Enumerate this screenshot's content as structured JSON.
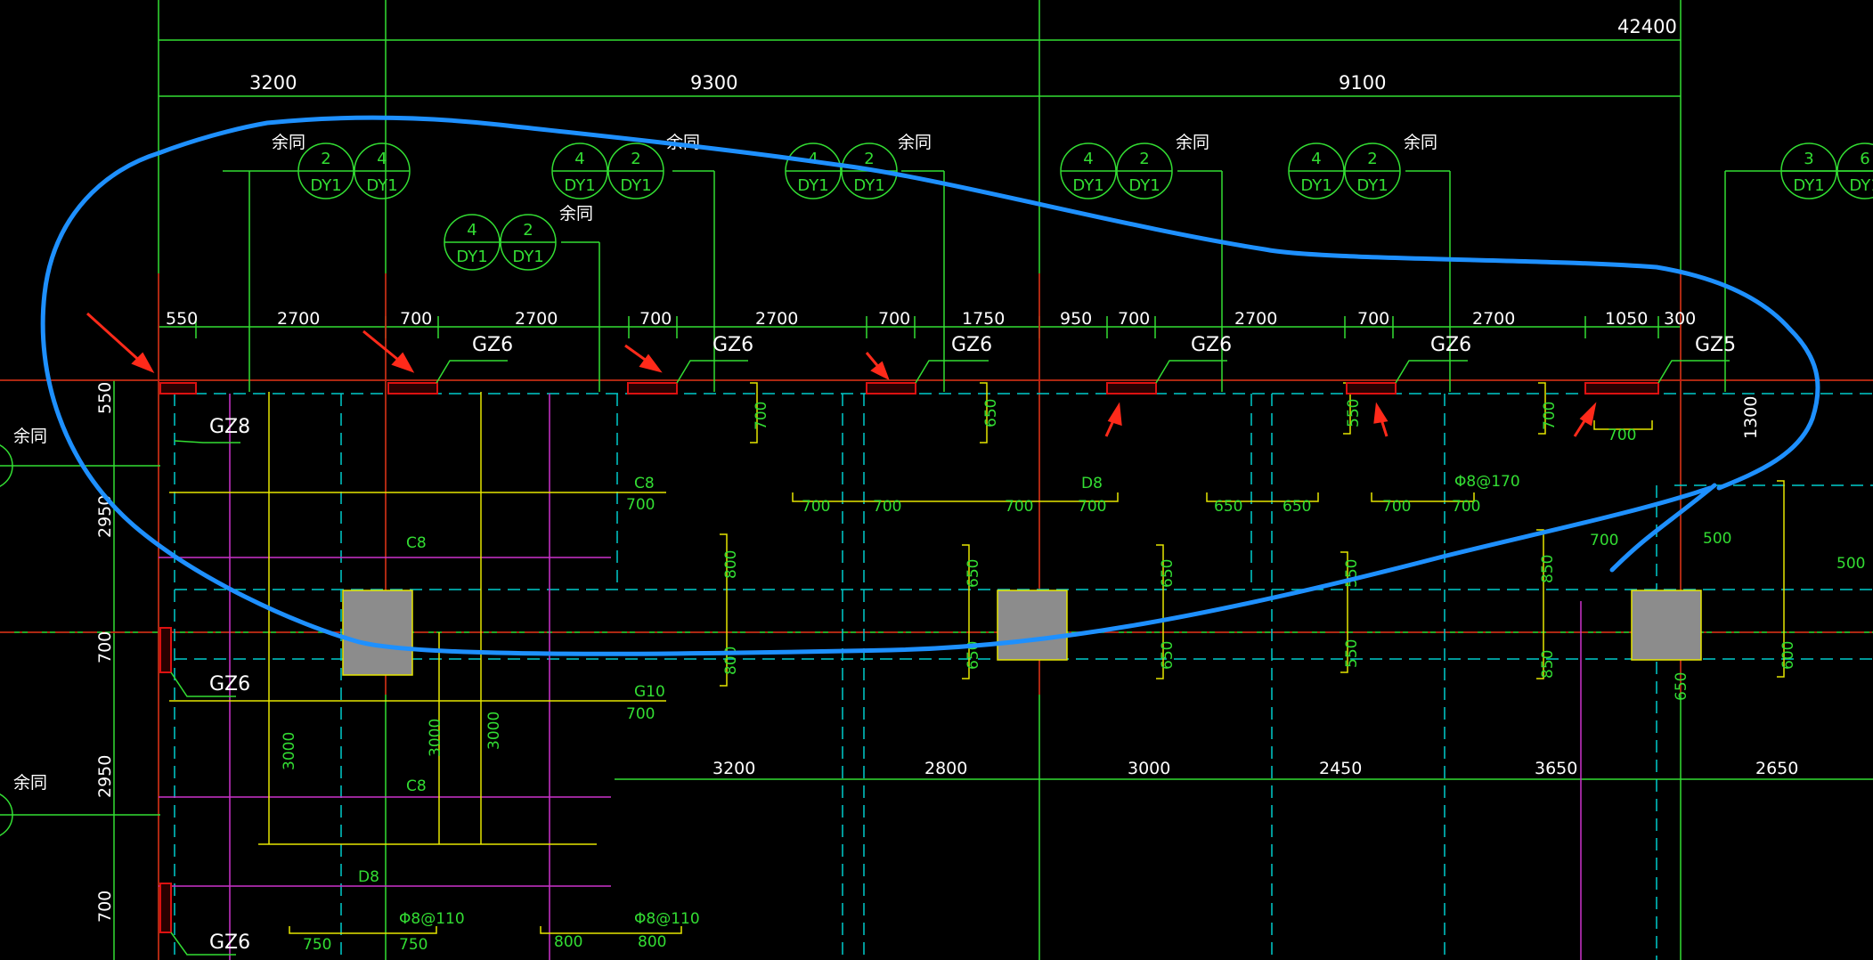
{
  "overall_dim": "42400",
  "span_dims": [
    "3200",
    "9300",
    "9100"
  ],
  "wall_segment_dims": [
    "550",
    "2700",
    "700",
    "2700",
    "700",
    "2700",
    "700",
    "1750",
    "950",
    "700",
    "2700",
    "700",
    "2700",
    "1050",
    "300"
  ],
  "column_labels": [
    "GZ6",
    "GZ6",
    "GZ6",
    "GZ6",
    "GZ6",
    "GZ5",
    "GZ8",
    "GZ6",
    "GZ6"
  ],
  "same_note": "余同",
  "bubbles": [
    {
      "top": "2",
      "bottom": "DY1"
    },
    {
      "top": "4",
      "bottom": "DY1"
    },
    {
      "top": "4",
      "bottom": "DY1"
    },
    {
      "top": "2",
      "bottom": "DY1"
    },
    {
      "top": "4",
      "bottom": "DY1"
    },
    {
      "top": "2",
      "bottom": "DY1"
    },
    {
      "top": "4",
      "bottom": "DY1"
    },
    {
      "top": "2",
      "bottom": "DY1"
    },
    {
      "top": "4",
      "bottom": "DY1"
    },
    {
      "top": "2",
      "bottom": "DY1"
    },
    {
      "top": "3",
      "bottom": "DY1"
    },
    {
      "top": "6",
      "bottom": "DY1"
    },
    {
      "top": "4",
      "bottom": "DY1"
    },
    {
      "top": "2",
      "bottom": "DY1"
    }
  ],
  "left_dims": [
    "550",
    "2950",
    "700",
    "2950",
    "700"
  ],
  "right_dim": "1300",
  "right_dim2": "700",
  "bottom_dims": [
    "3200",
    "2800",
    "3000",
    "2450",
    "3650",
    "2650"
  ],
  "green_labels": [
    "700",
    "650",
    "550",
    "700",
    "C8",
    "D8",
    "Φ8@170",
    "800",
    "800",
    "650",
    "650",
    "650",
    "650",
    "550",
    "550",
    "850",
    "850",
    "650",
    "600",
    "G10",
    "3000",
    "3000",
    "3000",
    "C8",
    "C8",
    "D8",
    "Φ8@110",
    "Φ8@110",
    "750",
    "750",
    "800",
    "800",
    "500",
    "500",
    "700",
    "700",
    "700",
    "700",
    "700",
    "700",
    "700",
    "650",
    "650",
    "700",
    "700"
  ],
  "colors": {
    "background": "#000000",
    "grid": "#33dd33",
    "cyan": "#00cccc",
    "yellow": "#e6e600",
    "magenta": "#cc33cc",
    "red": "#dd1111",
    "annotation": "#1e90ff",
    "arrow": "#ff2a1a",
    "fill": "#8c8c8c"
  }
}
